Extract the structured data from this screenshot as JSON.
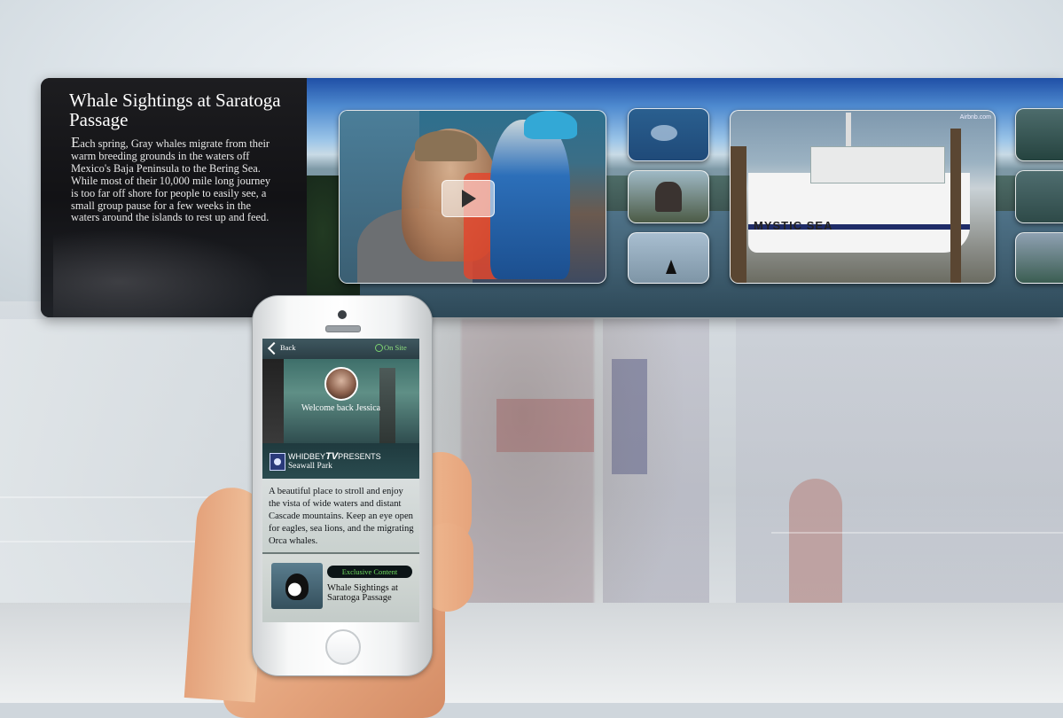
{
  "panel": {
    "title": "Whale Sightings at Saratoga Passage",
    "description": "Each spring, Gray whales migrate from their warm breeding grounds in the waters off Mexico's Baja Peninsula to the Bering Sea. While most of their 10,000 mile long journey is too far off shore for people to easily see, a small group pause for a few weeks in the waters around the islands to rest up and feed.",
    "boat_name": "MYSTIC SEA",
    "watermark": "Airbnb.com"
  },
  "phone": {
    "back_label": "Back",
    "onsite_label": "On Site",
    "welcome": "Welcome back Jessica",
    "brand_prefix": "WHIDBEY",
    "brand_tv": "TV",
    "brand_suffix": "PRESENTS",
    "place": "Seawall Park",
    "body": "A beautiful place to stroll and enjoy the vista of wide waters and distant Cascade mountains. Keep an eye open for eagles, sea lions, and the migrating Orca whales.",
    "exclusive_label": "Exclusive Content",
    "card_title": "Whale Sightings at Saratoga Passage"
  },
  "icons": [
    "play-icon",
    "chevron-left-icon",
    "location-pin-icon",
    "whidbey-logo-icon"
  ],
  "colors": {
    "onsite_green": "#8fe07f",
    "panel_bg": "#0c0c0f"
  }
}
